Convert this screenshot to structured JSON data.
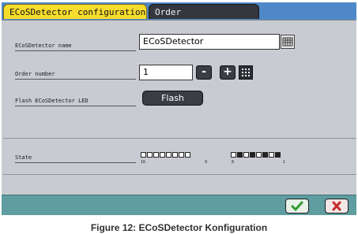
{
  "tabs": [
    {
      "label": "ECoSDetector configuration",
      "active": true
    },
    {
      "label": "Order",
      "active": false
    }
  ],
  "fields": {
    "name_label": "ECoSDetector name",
    "name_value": "ECoSDetector",
    "order_label": "Order number",
    "order_value": "1",
    "minus_label": "-",
    "plus_label": "+",
    "flash_label": "Flash ECoSDetector LED",
    "flash_button": "Flash"
  },
  "state": {
    "label": "State",
    "bits": [
      0,
      0,
      0,
      0,
      0,
      0,
      0,
      0,
      0,
      1,
      0,
      1,
      0,
      1,
      0,
      1
    ],
    "bit_labels": {
      "b16": "16",
      "b9": "9",
      "b8": "8",
      "b1": "1"
    }
  },
  "footer": {
    "ok_icon": "checkmark-icon",
    "cancel_icon": "x-icon"
  },
  "colors": {
    "active_tab": "#f6dc2d",
    "tabbar": "#4f88c8",
    "footer": "#5f9da1"
  },
  "caption": "Figure 12: ECoSDetector Konfiguration"
}
